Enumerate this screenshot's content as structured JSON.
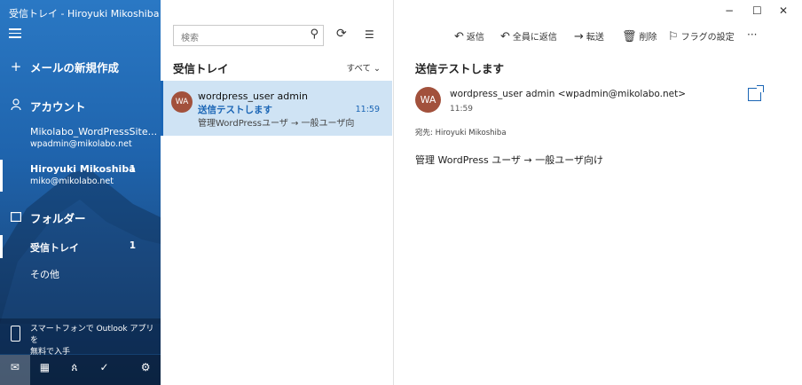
{
  "window": {
    "title": "受信トレイ - Hiroyuki Mikoshiba",
    "minimize": "−",
    "maximize": "☐",
    "close": "✕"
  },
  "sidebar": {
    "new_mail": "メールの新規作成",
    "accounts_label": "アカウント",
    "accounts": [
      {
        "name": "Mikolabo_WordPressSite...",
        "email": "wpadmin@mikolabo.net",
        "count": ""
      },
      {
        "name": "Hiroyuki Mikoshiba",
        "email": "miko@mikolabo.net",
        "count": "1"
      }
    ],
    "folders_label": "フォルダー",
    "folders": [
      {
        "label": "受信トレイ",
        "count": "1"
      },
      {
        "label": "その他",
        "count": ""
      }
    ],
    "promo_line1": "スマートフォンで Outlook アプリを",
    "promo_line2": "無料で入手"
  },
  "list": {
    "search_placeholder": "検索",
    "title": "受信トレイ",
    "filter": "すべて",
    "messages": [
      {
        "avatar": "WA",
        "from": "wordpress_user admin",
        "subject": "送信テストします",
        "time": "11:59",
        "preview": "管理WordPressユーザ → 一般ユーザ向"
      }
    ]
  },
  "reading": {
    "toolbar": {
      "reply": "返信",
      "reply_all": "全員に返信",
      "forward": "転送",
      "delete": "削除",
      "flag": "フラグの設定",
      "more": "···"
    },
    "subject": "送信テストします",
    "avatar": "WA",
    "from": "wordpress_user admin <wpadmin@mikolabo.net>",
    "time": "11:59",
    "to": "宛先: Hiroyuki Mikoshiba",
    "body": "管理 WordPress ユーザ → 一般ユーザ向け"
  },
  "colors": {
    "accent": "#1a65b5",
    "avatar": "#a2513c",
    "selected": "#cfe3f4"
  }
}
